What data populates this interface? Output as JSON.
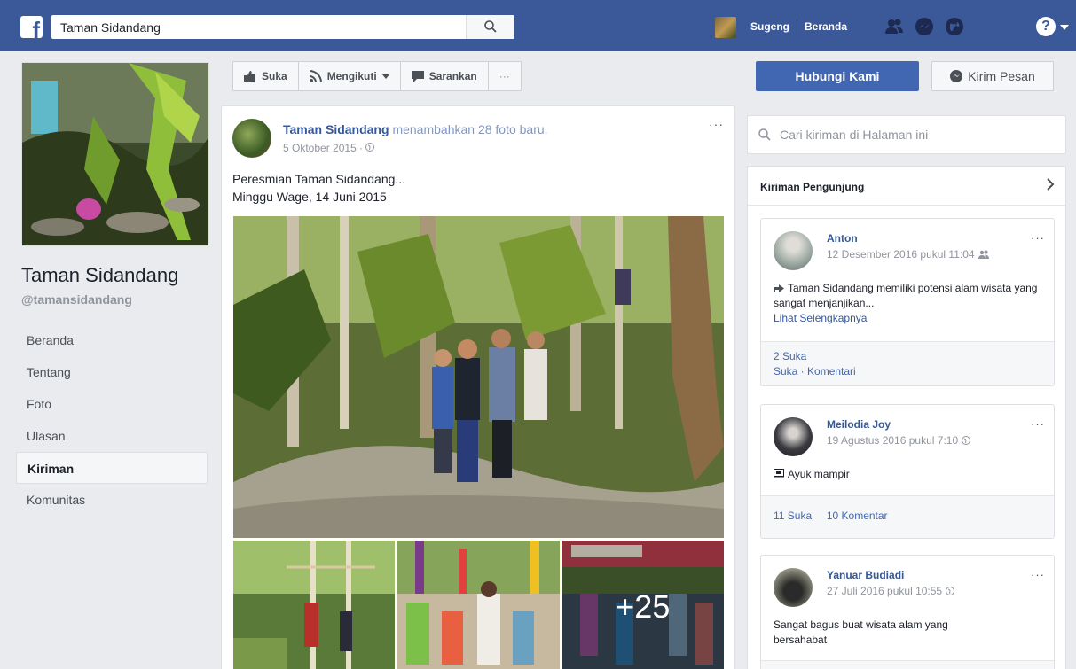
{
  "topbar": {
    "search_value": "Taman Sidandang",
    "user_name": "Sugeng",
    "home_label": "Beranda",
    "help_label": "?"
  },
  "left": {
    "page_title": "Taman Sidandang",
    "page_handle": "@tamansidandang",
    "nav": [
      {
        "label": "Beranda"
      },
      {
        "label": "Tentang"
      },
      {
        "label": "Foto"
      },
      {
        "label": "Ulasan"
      },
      {
        "label": "Kiriman"
      },
      {
        "label": "Komunitas"
      }
    ]
  },
  "actions": {
    "like_label": "Suka",
    "follow_label": "Mengikuti",
    "share_label": "Sarankan",
    "more_label": "···",
    "contact_label": "Hubungi Kami",
    "message_label": "Kirim Pesan"
  },
  "post": {
    "author": "Taman Sidandang",
    "action_text": "menambahkan 28 foto baru.",
    "date": "5 Oktober 2015 ·",
    "more": "···",
    "text_line1": "Peresmian Taman Sidandang...",
    "text_line2": "Minggu Wage, 14 Juni 2015",
    "more_photos": "+25"
  },
  "right": {
    "search_placeholder": "Cari kiriman di Halaman ini",
    "visitor_title": "Kiriman Pengunjung",
    "cards": [
      {
        "name": "Anton",
        "date": "12 Desember 2016 pukul 11:04",
        "more": "···",
        "body": "Taman Sidandang memiliki potensi alam wisata yang sangat menjanjikan...",
        "link": "Lihat Selengkapnya",
        "likes": "2 Suka",
        "actions": "Suka · Komentari"
      },
      {
        "name": "Meilodia Joy",
        "date": "19 Agustus 2016 pukul 7:10",
        "more": "···",
        "body": "Ayuk mampir",
        "likes": "11 Suka",
        "comments": "10 Komentar"
      },
      {
        "name": "Yanuar Budiadi",
        "date": "27 Juli 2016 pukul 10:55",
        "more": "···",
        "body": "Sangat bagus buat wisata alam yang bersahabat"
      }
    ]
  },
  "colors": {
    "brand": "#3b5998",
    "link": "#365899",
    "primary_button": "#4267b2",
    "background": "#e9ebee"
  }
}
